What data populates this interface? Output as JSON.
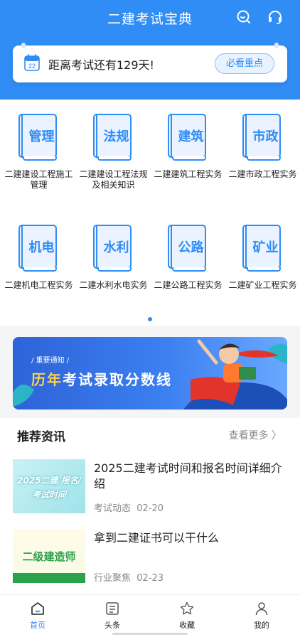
{
  "header": {
    "title": "二建考试宝典",
    "icons": [
      "search-icon",
      "headset-icon"
    ],
    "accent": "#2f8df5"
  },
  "countdown": {
    "calendar_day": "22",
    "text": "距离考试还有129天!",
    "button": "必看重点"
  },
  "subjects": [
    {
      "icon_text": "管理",
      "name": "二建建设工程施工管理"
    },
    {
      "icon_text": "法规",
      "name": "二建建设工程法规及相关知识"
    },
    {
      "icon_text": "建筑",
      "name": "二建建筑工程实务"
    },
    {
      "icon_text": "市政",
      "name": "二建市政工程实务"
    },
    {
      "icon_text": "机电",
      "name": "二建机电工程实务"
    },
    {
      "icon_text": "水利",
      "name": "二建水利水电实务"
    },
    {
      "icon_text": "公路",
      "name": "二建公路工程实务"
    },
    {
      "icon_text": "矿业",
      "name": "二建矿业工程实务"
    }
  ],
  "banner": {
    "tag": "/ 重要通知 /",
    "title_highlight": "历年",
    "title_rest": "考试录取分数线"
  },
  "news_section": {
    "title": "推荐资讯",
    "more": "查看更多 〉",
    "items": [
      {
        "thumb_text": "2025二建 报名/考试时间",
        "title": "2025二建考试时间和报名时间详细介绍",
        "category": "考试动态",
        "date": "02-20"
      },
      {
        "thumb_text": "二级建造师",
        "title": "拿到二建证书可以干什么",
        "category": "行业聚焦",
        "date": "02-23"
      }
    ]
  },
  "tabs": [
    {
      "label": "首页",
      "icon": "home-icon"
    },
    {
      "label": "头条",
      "icon": "news-icon"
    },
    {
      "label": "收藏",
      "icon": "star-icon"
    },
    {
      "label": "我的",
      "icon": "user-icon"
    }
  ]
}
